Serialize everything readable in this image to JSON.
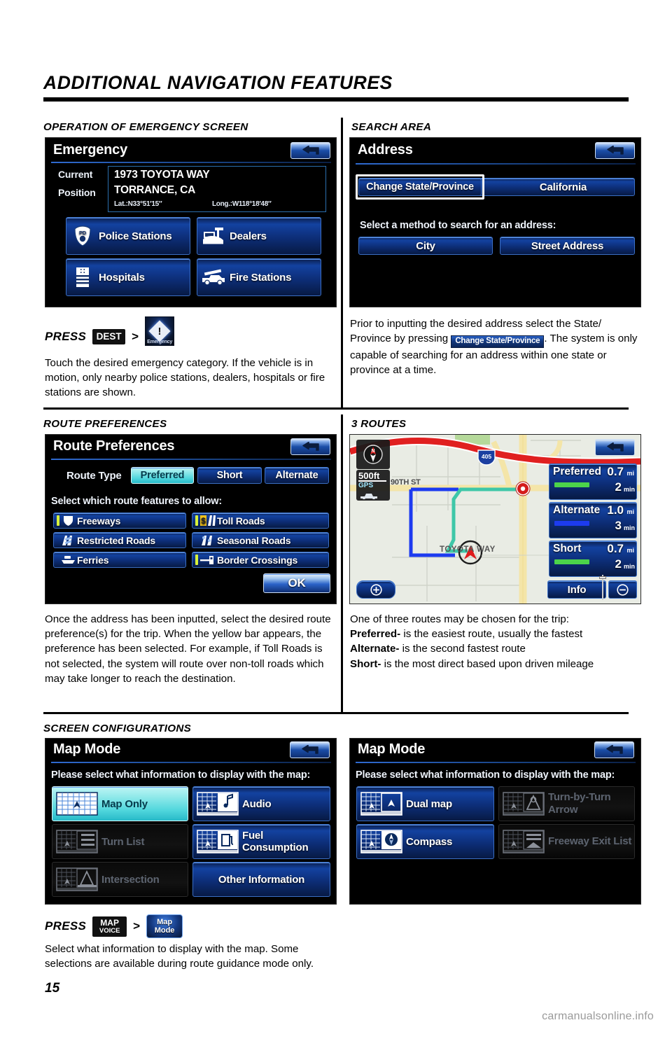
{
  "page": {
    "title": "ADDITIONAL NAVIGATION FEATURES",
    "number": "15",
    "watermark": "carmanualsonline.info"
  },
  "sections": {
    "emergency": {
      "heading": "OPERATION OF EMERGENCY SCREEN",
      "screen": {
        "title": "Emergency",
        "back_icon": "back-arrow-icon",
        "current_label_1": "Current",
        "current_label_2": "Position",
        "address_line1": "1973 TOYOTA WAY",
        "address_line2": "TORRANCE, CA",
        "lat": "Lat.:N33°51′15″",
        "long": "Long.:W118°18′48″",
        "buttons": [
          {
            "label": "Police Stations",
            "icon": "police-badge-icon"
          },
          {
            "label": "Dealers",
            "icon": "dealership-icon"
          },
          {
            "label": "Hospitals",
            "icon": "hospital-icon"
          },
          {
            "label": "Fire Stations",
            "icon": "fire-truck-icon"
          }
        ]
      },
      "press": {
        "word": "PRESS",
        "hard_key": "DEST",
        "arrow": ">",
        "soft_key": "Emergency",
        "soft_key_icon": "exclamation-diamond-icon"
      },
      "body": "Touch the desired emergency category. If the vehicle is in motion, only nearby police stations, dealers, hospitals or fire stations are shown."
    },
    "search_area": {
      "heading": "SEARCH AREA",
      "screen": {
        "title": "Address",
        "back_icon": "back-arrow-icon",
        "change_state_button": "Change State/Province",
        "state_value": "California",
        "method_label": "Select a method to search for an address:",
        "method_buttons": [
          "City",
          "Street Address"
        ]
      },
      "body_pre": "Prior to inputting the desired address select the State/ Province by pressing ",
      "body_chip": "Change State/Province",
      "body_post": ". The system is only capable of searching for an address within one state or province at a time."
    },
    "route_preferences": {
      "heading": "ROUTE PREFERENCES",
      "screen": {
        "title": "Route Preferences",
        "back_icon": "back-arrow-icon",
        "route_type_label": "Route Type",
        "route_types": [
          {
            "label": "Preferred",
            "selected": true
          },
          {
            "label": "Short",
            "selected": false
          },
          {
            "label": "Alternate",
            "selected": false
          }
        ],
        "features_label": "Select which route features to allow:",
        "features": [
          {
            "label": "Freeways",
            "icon": "freeway-shield-icon",
            "allowed": true
          },
          {
            "label": "Toll Roads",
            "icon": "toll-dollar-icon",
            "allowed": true
          },
          {
            "label": "Restricted Roads",
            "icon": "restricted-road-icon",
            "allowed": false
          },
          {
            "label": "Seasonal Roads",
            "icon": "seasonal-road-icon",
            "allowed": false
          },
          {
            "label": "Ferries",
            "icon": "ferry-icon",
            "allowed": false
          },
          {
            "label": "Border Crossings",
            "icon": "border-gate-icon",
            "allowed": true
          }
        ],
        "ok_button": "OK"
      },
      "body": "Once the address has been inputted, select the desired route preference(s) for the trip. When the yellow bar appears, the preference has been selected. For example, if Toll Roads is not selected, the system will route over non-toll roads which may take longer to reach the destination."
    },
    "three_routes": {
      "heading": "3 ROUTES",
      "screen": {
        "back_icon": "back-arrow-icon",
        "compass_icon": "north-compass-icon",
        "scale": "500ft",
        "gps": "GPS",
        "traffic_icon": "traffic-icon",
        "street_label_1": "90TH ST",
        "street_label_2": "TOYOTA WAY",
        "freeway_shield": "405",
        "zoom_in_icon": "zoom-in-icon",
        "zoom_out_icon": "zoom-out-icon",
        "info_button": "Info",
        "routes": [
          {
            "name": "Preferred",
            "distance": "0.7",
            "dist_unit": "mi",
            "time": "2",
            "time_unit": "min",
            "color": "#4cd34a"
          },
          {
            "name": "Alternate",
            "distance": "1.0",
            "dist_unit": "mi",
            "time": "3",
            "time_unit": "min",
            "color": "#1d3bf0"
          },
          {
            "name": "Short",
            "distance": "0.7",
            "dist_unit": "mi",
            "time": "2",
            "time_unit": "min",
            "color": "#4cd34a"
          }
        ]
      },
      "body_line1": "One of three routes may be chosen for the trip:",
      "body_items": [
        {
          "term": "Preferred-",
          "desc": " is the easiest route, usually the fastest"
        },
        {
          "term": "Alternate-",
          "desc": " is the second fastest route"
        },
        {
          "term": "Short-",
          "desc": " is the most direct based upon driven mileage"
        }
      ]
    },
    "screen_configurations": {
      "heading": "SCREEN CONFIGURATIONS",
      "screen_left": {
        "title": "Map Mode",
        "back_icon": "back-arrow-icon",
        "prompt": "Please select what information to display with the map:",
        "buttons": [
          {
            "label": "Map Only",
            "icon": "map-grid-icon",
            "state": "selected"
          },
          {
            "label": "Audio",
            "icon": "map-audio-icon",
            "state": "enabled"
          },
          {
            "label": "Turn List",
            "icon": "map-turnlist-icon",
            "state": "disabled"
          },
          {
            "label": "Fuel Consumption",
            "icon": "map-fuel-icon",
            "state": "enabled"
          },
          {
            "label": "Intersection",
            "icon": "map-intersection-icon",
            "state": "disabled"
          },
          {
            "label": "Other Information",
            "icon": "",
            "state": "enabled"
          }
        ]
      },
      "screen_right": {
        "title": "Map Mode",
        "back_icon": "back-arrow-icon",
        "prompt": "Please select what information to display with the map:",
        "buttons": [
          {
            "label": "Dual map",
            "icon": "map-dual-icon",
            "state": "enabled"
          },
          {
            "label": "Turn-by-Turn Arrow",
            "icon": "map-turnarrow-icon",
            "state": "disabled"
          },
          {
            "label": "Compass",
            "icon": "map-compass-icon",
            "state": "enabled"
          },
          {
            "label": "Freeway Exit List",
            "icon": "map-freewayexit-icon",
            "state": "disabled"
          }
        ]
      },
      "press": {
        "word": "PRESS",
        "hard_key_line1": "MAP",
        "hard_key_line2": "VOICE",
        "arrow": ">",
        "soft_key_line1": "Map",
        "soft_key_line2": "Mode"
      },
      "body": "Select what information to display with the map. Some selections are available during route guidance mode only."
    }
  },
  "colors": {
    "accent_blue": "#1342a0",
    "selected_cyan": "#4fd6dc",
    "yellow_indicator": "#d9f23a",
    "disabled_text": "#5d6470"
  }
}
